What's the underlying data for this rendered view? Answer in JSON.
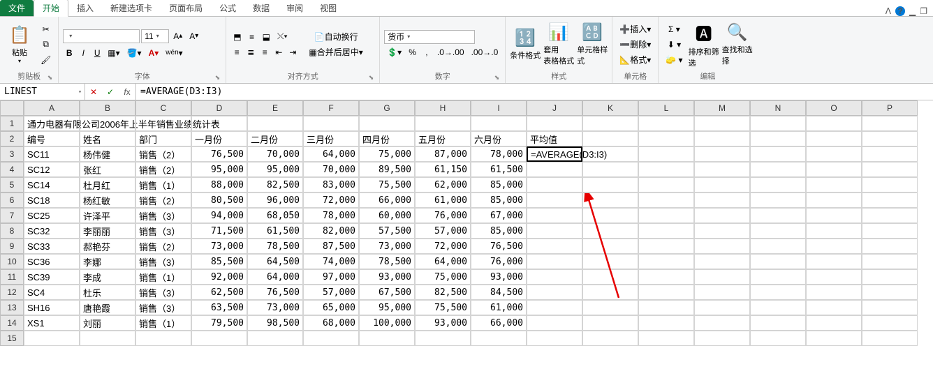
{
  "tabs": {
    "file": "文件",
    "items": [
      "开始",
      "插入",
      "新建选项卡",
      "页面布局",
      "公式",
      "数据",
      "审阅",
      "视图"
    ],
    "active_index": 0
  },
  "ribbon": {
    "clipboard": {
      "paste": "粘贴",
      "label": "剪贴板"
    },
    "font": {
      "label": "字体",
      "size": "11",
      "bold": "B",
      "italic": "I",
      "underline": "U"
    },
    "alignment": {
      "label": "对齐方式",
      "wrap": "自动换行",
      "merge": "合并后居中"
    },
    "number": {
      "label": "数字",
      "format": "货币"
    },
    "styles": {
      "label": "样式",
      "cond": "条件格式",
      "table": "套用\n表格格式",
      "cell": "单元格样式"
    },
    "cells": {
      "label": "单元格",
      "insert": "插入",
      "delete": "删除",
      "format": "格式"
    },
    "editing": {
      "label": "编辑",
      "sort": "排序和筛选",
      "find": "查找和选择"
    }
  },
  "formula_bar": {
    "name": "LINEST",
    "formula": "=AVERAGE(D3:I3)"
  },
  "grid": {
    "columns": [
      "A",
      "B",
      "C",
      "D",
      "E",
      "F",
      "G",
      "H",
      "I",
      "J",
      "K",
      "L",
      "M",
      "N",
      "O",
      "P"
    ],
    "title": "通力电器有限公司2006年上半年销售业绩统计表",
    "headers": [
      "编号",
      "姓名",
      "部门",
      "一月份",
      "二月份",
      "三月份",
      "四月份",
      "五月份",
      "六月份",
      "平均值"
    ],
    "rows": [
      {
        "id": "SC11",
        "name": "杨伟健",
        "dept": "销售（2）",
        "m": [
          "76,500",
          "70,000",
          "64,000",
          "75,000",
          "87,000",
          "78,000"
        ],
        "avg": "=AVERAGE(D3:I3)"
      },
      {
        "id": "SC12",
        "name": "张红",
        "dept": "销售（2）",
        "m": [
          "95,000",
          "95,000",
          "70,000",
          "89,500",
          "61,150",
          "61,500"
        ],
        "avg": ""
      },
      {
        "id": "SC14",
        "name": "杜月红",
        "dept": "销售（1）",
        "m": [
          "88,000",
          "82,500",
          "83,000",
          "75,500",
          "62,000",
          "85,000"
        ],
        "avg": ""
      },
      {
        "id": "SC18",
        "name": "杨红敏",
        "dept": "销售（2）",
        "m": [
          "80,500",
          "96,000",
          "72,000",
          "66,000",
          "61,000",
          "85,000"
        ],
        "avg": ""
      },
      {
        "id": "SC25",
        "name": "许泽平",
        "dept": "销售（3）",
        "m": [
          "94,000",
          "68,050",
          "78,000",
          "60,000",
          "76,000",
          "67,000"
        ],
        "avg": ""
      },
      {
        "id": "SC32",
        "name": "李丽丽",
        "dept": "销售（3）",
        "m": [
          "71,500",
          "61,500",
          "82,000",
          "57,500",
          "57,000",
          "85,000"
        ],
        "avg": ""
      },
      {
        "id": "SC33",
        "name": "郝艳芬",
        "dept": "销售（2）",
        "m": [
          "73,000",
          "78,500",
          "87,500",
          "73,000",
          "72,000",
          "76,500"
        ],
        "avg": ""
      },
      {
        "id": "SC36",
        "name": "李娜",
        "dept": "销售（3）",
        "m": [
          "85,500",
          "64,500",
          "74,000",
          "78,500",
          "64,000",
          "76,000"
        ],
        "avg": ""
      },
      {
        "id": "SC39",
        "name": "李成",
        "dept": "销售（1）",
        "m": [
          "92,000",
          "64,000",
          "97,000",
          "93,000",
          "75,000",
          "93,000"
        ],
        "avg": ""
      },
      {
        "id": "SC4",
        "name": "杜乐",
        "dept": "销售（3）",
        "m": [
          "62,500",
          "76,500",
          "57,000",
          "67,500",
          "82,500",
          "84,500"
        ],
        "avg": ""
      },
      {
        "id": "SH16",
        "name": "唐艳霞",
        "dept": "销售（3）",
        "m": [
          "63,500",
          "73,000",
          "65,000",
          "95,000",
          "75,500",
          "61,000"
        ],
        "avg": ""
      },
      {
        "id": "XS1",
        "name": "刘丽",
        "dept": "销售（1）",
        "m": [
          "79,500",
          "98,500",
          "68,000",
          "100,000",
          "93,000",
          "66,000"
        ],
        "avg": ""
      }
    ],
    "active_cell": "J3"
  }
}
